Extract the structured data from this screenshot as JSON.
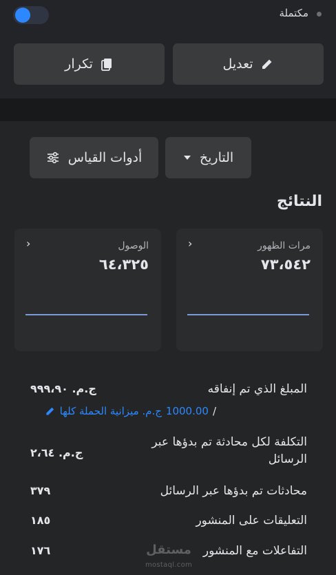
{
  "header": {
    "status_label": "مكتملة",
    "toggle_on": true
  },
  "actions": {
    "edit_label": "تعديل",
    "duplicate_label": "تكرار"
  },
  "filters": {
    "date_label": "التاريخ",
    "tools_label": "أدوات القياس"
  },
  "results": {
    "title": "النتائج",
    "cards": [
      {
        "label": "مرات الظهور",
        "value": "٧٣،٥٤٢"
      },
      {
        "label": "الوصول",
        "value": "٦٤،٣٢٥"
      }
    ]
  },
  "metrics": {
    "spent_label": "المبلغ الذي تم إنفاقه",
    "spent_value": "ج.م. ٩٩٩،٩٠",
    "budget_value": "1000.00",
    "budget_text": "ج.م. ميزانية الحملة كلها",
    "budget_sep": "/",
    "cost_label": "التكلفة لكل محادثة تم بدؤها عبر الرسائل",
    "cost_value": "ج.م. ٢،٦٤",
    "conversations_label": "محادثات تم بدؤها عبر الرسائل",
    "conversations_value": "٣٧٩",
    "comments_label": "التعليقات على المنشور",
    "comments_value": "١٨٥",
    "engagement_label": "التفاعلات مع المنشور",
    "engagement_value": "١٧٦"
  },
  "watermark": {
    "brand": "مستقل",
    "domain": "mostaql.com"
  },
  "colors": {
    "accent": "#2d88ff",
    "background": "#242526",
    "button": "#3a3b3c"
  }
}
